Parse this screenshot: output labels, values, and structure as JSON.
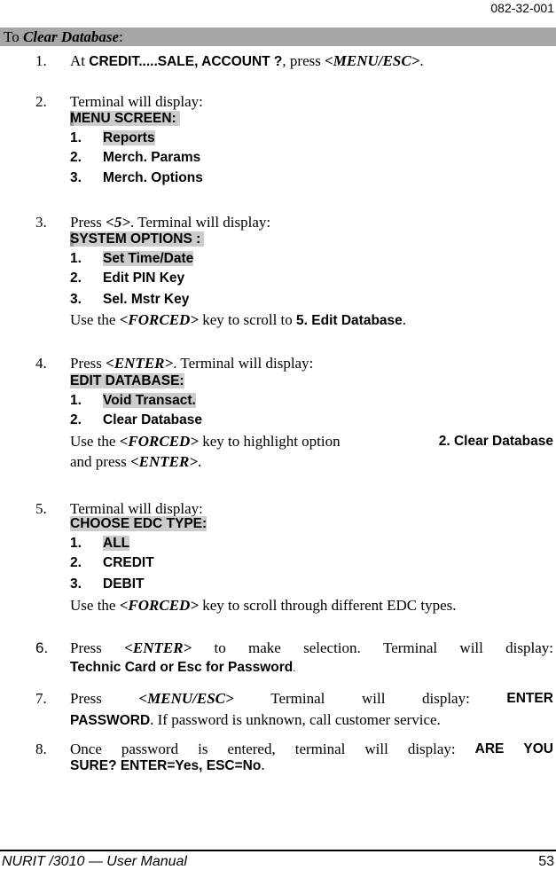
{
  "header": {
    "doc_number": "082-32-001"
  },
  "section": {
    "prefix": "To ",
    "title": "Clear Database",
    "suffix": ":"
  },
  "steps": [
    {
      "num": "1.",
      "pre": "At ",
      "bold": "CREDIT.....SALE, ACCOUNT ?",
      "mid": ", press ",
      "key": "<MENU/ESC>",
      "post": "."
    },
    {
      "num": "2.",
      "intro": "Terminal will display:",
      "screen_title": "MENU SCREEN:",
      "options": [
        {
          "n": "1.",
          "label": "Reports"
        },
        {
          "n": "2.",
          "label": "Merch. Params"
        },
        {
          "n": "3.",
          "label": "Merch. Options"
        }
      ]
    },
    {
      "num": "3.",
      "intro_pre": "Press ",
      "intro_key": "<5>",
      "intro_post": ". Terminal will display:",
      "screen_title": "SYSTEM OPTIONS :",
      "options": [
        {
          "n": "1.",
          "label": "Set Time/Date"
        },
        {
          "n": "2.",
          "label": "Edit PIN Key"
        },
        {
          "n": "3.",
          "label": "Sel. Mstr Key"
        }
      ],
      "note_pre": "Use the ",
      "note_key": "<FORCED>",
      "note_mid": " key to scroll to ",
      "note_bold": "5. Edit Database",
      "note_post": "."
    },
    {
      "num": "4.",
      "intro_pre": "Press ",
      "intro_key": "<ENTER>",
      "intro_post": ". Terminal will display:",
      "screen_title": "EDIT DATABASE:",
      "options": [
        {
          "n": "1.",
          "label": "Void Transact."
        },
        {
          "n": "2.",
          "label": "Clear Database"
        }
      ],
      "note_pre": "Use the ",
      "note_key": "<FORCED>",
      "note_mid": " key to highlight option ",
      "note_bold": "2. Clear Database",
      "note_line2_pre": "and press ",
      "note_line2_key": "<ENTER>",
      "note_post": "."
    },
    {
      "num": "5.",
      "intro": "Terminal will display:",
      "screen_title": "CHOOSE EDC TYPE:",
      "options": [
        {
          "n": "1.",
          "label": "ALL"
        },
        {
          "n": "2.",
          "label": "CREDIT"
        },
        {
          "n": "3.",
          "label": "DEBIT"
        }
      ],
      "note_pre": "Use the ",
      "note_key": "<FORCED>",
      "note_post": " key to scroll through different EDC types."
    },
    {
      "num": "6.",
      "pre": "Press ",
      "key": "<ENTER>",
      "mid": " to make selection.  Terminal will display:",
      "bold": "Technic Card or Esc for Password",
      "post": "."
    },
    {
      "num": "7.",
      "pre": "Press ",
      "key": "<MENU/ESC>",
      "mid": ". Terminal will display: ",
      "bold1": "ENTER",
      "bold2": "PASSWORD",
      "post": ".  If password is unknown, call customer service."
    },
    {
      "num": "8.",
      "pre": "Once password is entered, terminal will display: ",
      "bold1": "ARE YOU",
      "bold2": "SURE? ENTER=Yes, ESC=No",
      "post": "."
    }
  ],
  "footer": {
    "title": "NURIT /3010 — User Manual",
    "page": "53"
  }
}
